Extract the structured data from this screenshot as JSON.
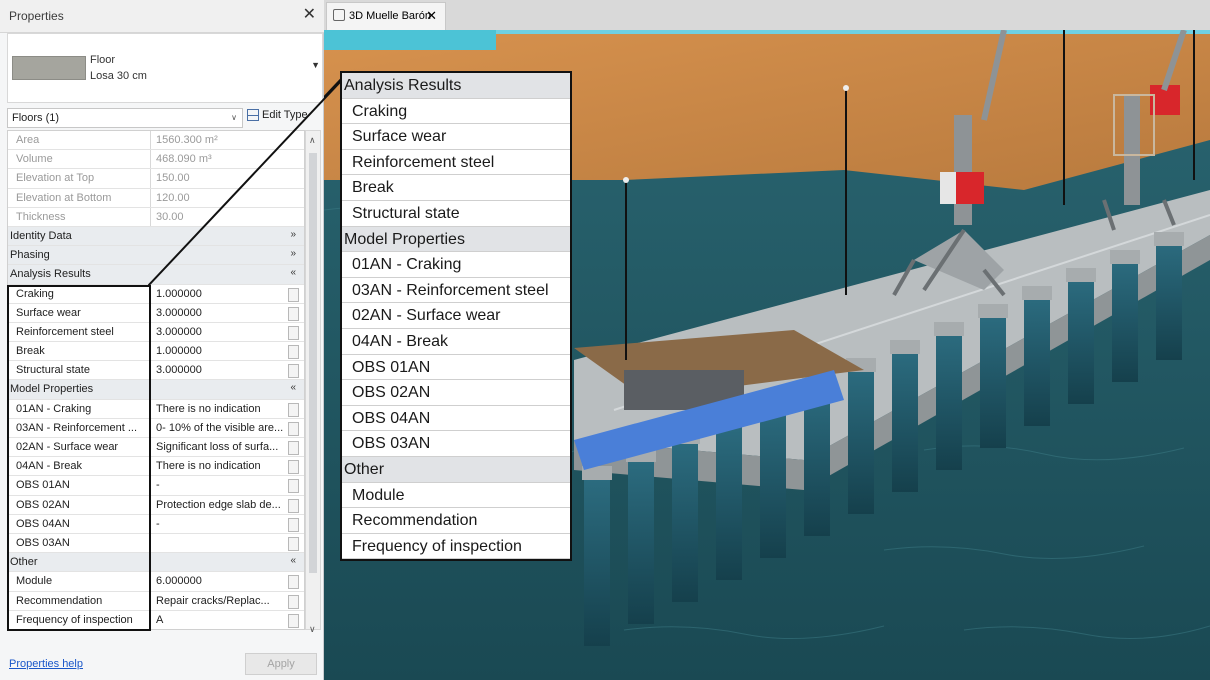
{
  "panel": {
    "title": "Properties",
    "type": {
      "category": "Floor",
      "name": "Losa 30 cm"
    },
    "filter": "Floors (1)",
    "edit_type_label": "Edit Type",
    "rows": [
      {
        "kind": "prop",
        "label": "Area",
        "value": "1560.300 m²",
        "disabled": true
      },
      {
        "kind": "prop",
        "label": "Volume",
        "value": "468.090 m³",
        "disabled": true
      },
      {
        "kind": "prop",
        "label": "Elevation at Top",
        "value": "150.00",
        "disabled": true
      },
      {
        "kind": "prop",
        "label": "Elevation at Bottom",
        "value": "120.00",
        "disabled": true
      },
      {
        "kind": "prop",
        "label": "Thickness",
        "value": "30.00",
        "disabled": true
      },
      {
        "kind": "group",
        "label": "Identity Data",
        "toggle": "»"
      },
      {
        "kind": "group",
        "label": "Phasing",
        "toggle": "»"
      },
      {
        "kind": "group",
        "label": "Analysis Results",
        "toggle": "«"
      },
      {
        "kind": "prop",
        "label": "Craking",
        "value": "1.000000"
      },
      {
        "kind": "prop",
        "label": "Surface wear",
        "value": "3.000000"
      },
      {
        "kind": "prop",
        "label": "Reinforcement steel",
        "value": "3.000000"
      },
      {
        "kind": "prop",
        "label": "Break",
        "value": "1.000000"
      },
      {
        "kind": "prop",
        "label": "Structural state",
        "value": "3.000000"
      },
      {
        "kind": "group",
        "label": "Model Properties",
        "toggle": "«"
      },
      {
        "kind": "prop",
        "label": "01AN - Craking",
        "value": "There is no indication"
      },
      {
        "kind": "prop",
        "label": "03AN - Reinforcement ...",
        "value": "0- 10% of the visible are..."
      },
      {
        "kind": "prop",
        "label": "02AN - Surface wear",
        "value": "Significant loss of surfa..."
      },
      {
        "kind": "prop",
        "label": "04AN - Break",
        "value": "There is no indication"
      },
      {
        "kind": "prop",
        "label": "OBS 01AN",
        "value": "-"
      },
      {
        "kind": "prop",
        "label": "OBS 02AN",
        "value": "Protection edge slab de..."
      },
      {
        "kind": "prop",
        "label": "OBS 04AN",
        "value": "-"
      },
      {
        "kind": "prop",
        "label": "OBS 03AN",
        "value": ""
      },
      {
        "kind": "group",
        "label": "Other",
        "toggle": "«"
      },
      {
        "kind": "prop",
        "label": "Module",
        "value": "6.000000"
      },
      {
        "kind": "prop",
        "label": "Recommendation",
        "value": "Repair cracks/Replac..."
      },
      {
        "kind": "prop",
        "label": "Frequency of inspection",
        "value": "A"
      }
    ],
    "help_label": "Properties help",
    "apply_label": "Apply"
  },
  "view": {
    "tab_label": "3D Muelle Barón"
  },
  "callout": [
    {
      "kind": "group",
      "label": "Analysis Results"
    },
    {
      "kind": "item",
      "label": "Craking"
    },
    {
      "kind": "item",
      "label": "Surface wear"
    },
    {
      "kind": "item",
      "label": "Reinforcement steel"
    },
    {
      "kind": "item",
      "label": "Break"
    },
    {
      "kind": "item",
      "label": "Structural state"
    },
    {
      "kind": "group",
      "label": "Model Properties"
    },
    {
      "kind": "item",
      "label": "01AN - Craking"
    },
    {
      "kind": "item",
      "label": "03AN - Reinforcement steel"
    },
    {
      "kind": "item",
      "label": "02AN - Surface wear"
    },
    {
      "kind": "item",
      "label": "04AN - Break"
    },
    {
      "kind": "item",
      "label": "OBS 01AN"
    },
    {
      "kind": "item",
      "label": "OBS 02AN"
    },
    {
      "kind": "item",
      "label": "OBS 04AN"
    },
    {
      "kind": "item",
      "label": "OBS 03AN"
    },
    {
      "kind": "group",
      "label": "Other"
    },
    {
      "kind": "item",
      "label": "Module"
    },
    {
      "kind": "item",
      "label": "Recommendation"
    },
    {
      "kind": "item",
      "label": "Frequency of inspection"
    }
  ],
  "colors": {
    "sea": "#1f5560",
    "sand": "#c98a49",
    "crane_red": "#d8262b",
    "deck": "#b9bec0"
  }
}
